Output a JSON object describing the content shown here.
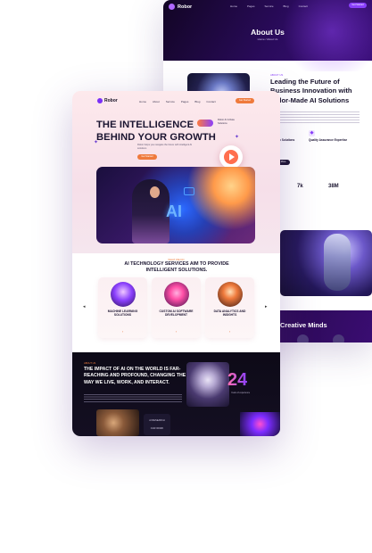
{
  "back_page": {
    "brand": "Robor",
    "nav": [
      "Home",
      "Pages",
      "Service",
      "Blog",
      "Contact"
    ],
    "cta": "Get Started",
    "hero_title": "About Us",
    "breadcrumb": "Home / About Us",
    "eyebrow": "ABOUT US",
    "heading": "Leading the Future of Business Innovation with Tailor-Made AI Solutions",
    "features": [
      "Custom Solutions",
      "Quality Assurance Expertise"
    ],
    "more_button": "Learn More",
    "stats": [
      {
        "value": "7k"
      },
      {
        "value": "38M"
      }
    ],
    "footer_title": "Creative Minds"
  },
  "front_page": {
    "brand": "Robor",
    "nav": [
      "Home",
      "About",
      "Service",
      "Pages",
      "Blog",
      "Contact"
    ],
    "cta": "Get Started",
    "headline_line1": "THE INTELLIGENCE",
    "headline_line2": "BEHIND YOUR GROWTH",
    "tagline": "Robor AI & Data Solutions",
    "subtext": "Robor helps you navigate the future with intelligent AI solutions",
    "primary_button": "Get Started",
    "hero_image_text": "AI",
    "services_eyebrow": "WHAT WE DO",
    "services_heading": "AI TECHNOLOGY SERVICES AIM TO PROVIDE INTELLIGENT SOLUTIONS.",
    "services": [
      {
        "title": "MACHINE LEARNING SOLUTIONS",
        "color": "#8a3ffc"
      },
      {
        "title": "CUSTOM AI SOFTWARE DEVELOPMENT",
        "color": "#ff4fa6"
      },
      {
        "title": "DATA ANALYTICS AND INSIGHTS",
        "color": "#ef7a3c"
      }
    ],
    "dark_eyebrow": "ABOUT US",
    "dark_heading": "THE IMPACT OF AI ON THE WORLD IS FAR-REACHING AND PROFOUND, CHANGING THE WAY WE LIVE, WORK, AND INTERACT.",
    "big_number": "24",
    "big_number_label": "Years of experience",
    "box_labels": [
      "AI RESEARCH",
      "OUR WORK"
    ]
  },
  "colors": {
    "accent_orange": "#ef7a3c",
    "accent_purple": "#8a3ffc",
    "dark_bg": "#0d0a17"
  }
}
